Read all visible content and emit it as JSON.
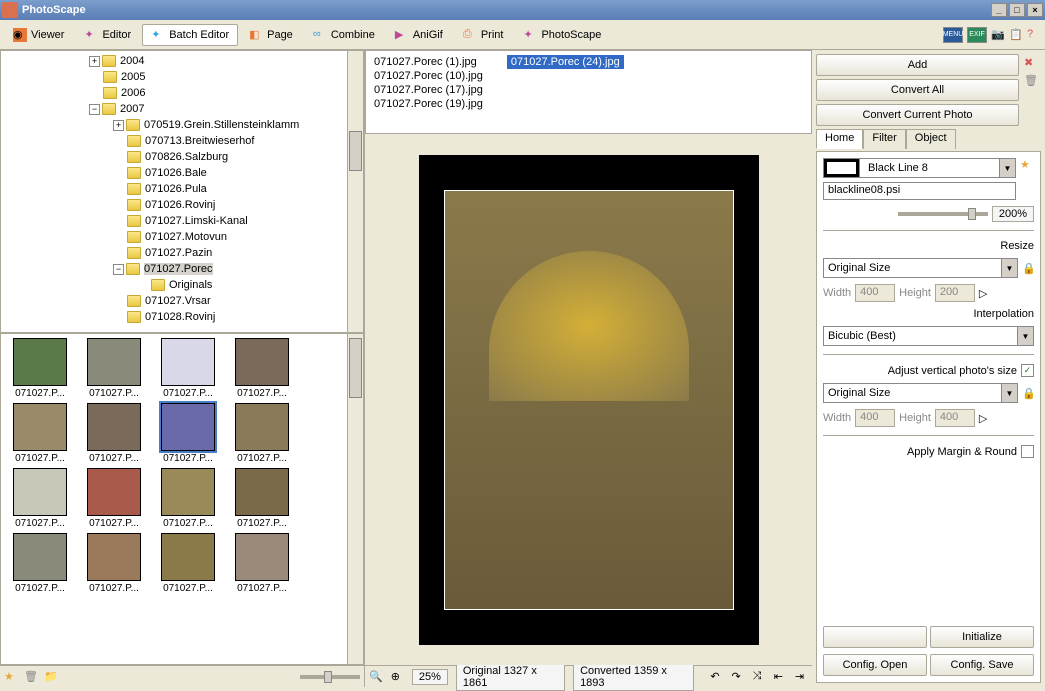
{
  "window": {
    "title": "PhotoScape"
  },
  "toolbar": {
    "viewer": "Viewer",
    "editor": "Editor",
    "batch": "Batch Editor",
    "page": "Page",
    "combine": "Combine",
    "anigif": "AniGif",
    "print": "Print",
    "photoscape": "PhotoScape",
    "menu": "MENU",
    "exif": "EXIF"
  },
  "tree": {
    "years": [
      "2004",
      "2005",
      "2006",
      "2007"
    ],
    "folders": [
      "070519.Grein.Stillensteinklamm",
      "070713.Breitwieserhof",
      "070826.Salzburg",
      "071026.Bale",
      "071026.Pula",
      "071026.Rovinj",
      "071027.Limski-Kanal",
      "071027.Motovun",
      "071027.Pazin",
      "071027.Porec",
      "Originals",
      "071027.Vrsar",
      "071028.Rovinj"
    ]
  },
  "thumbs": [
    "071027.P...",
    "071027.P...",
    "071027.P...",
    "071027.P...",
    "071027.P...",
    "071027.P...",
    "071027.P...",
    "071027.P...",
    "071027.P...",
    "071027.P...",
    "071027.P...",
    "071027.P...",
    "071027.P...",
    "071027.P...",
    "071027.P...",
    "071027.P..."
  ],
  "filelist": {
    "col1": [
      "071027.Porec (1).jpg",
      "071027.Porec (10).jpg",
      "071027.Porec (17).jpg",
      "071027.Porec (19).jpg"
    ],
    "col2": [
      "071027.Porec (24).jpg"
    ]
  },
  "status": {
    "zoom": "25%",
    "original": "Original 1327 x 1861",
    "converted": "Converted 1359 x 1893"
  },
  "right": {
    "add": "Add",
    "convert_all": "Convert All",
    "convert_current": "Convert Current Photo",
    "tab_home": "Home",
    "tab_filter": "Filter",
    "tab_object": "Object",
    "frame_name": "Black Line 8",
    "frame_file": "blackline08.psi",
    "zoom_pct": "200%",
    "resize": "Resize",
    "original_size": "Original Size",
    "width_label": "Width",
    "width_val": "400",
    "height_label": "Height",
    "height_val": "200",
    "interpolation": "Interpolation",
    "bicubic": "Bicubic (Best)",
    "adjust_vertical": "Adjust vertical photo's size",
    "height_val2": "400",
    "apply_margin": "Apply Margin & Round",
    "initialize": "Initialize",
    "config_open": "Config. Open",
    "config_save": "Config. Save"
  }
}
